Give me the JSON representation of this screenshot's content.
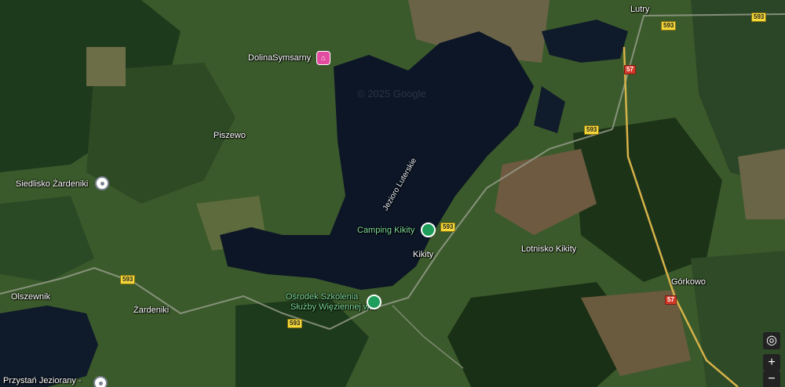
{
  "places": {
    "lutry": "Lutry",
    "dolina": "DolinaSymsarny",
    "piszewo": "Piszewo",
    "siedlisko": "Siedlisko Żardeniki",
    "camping": "Camping Kikity",
    "kikity": "Kikity",
    "lotnisko": "Lotnisko Kikity",
    "gorkowo": "Górkowo",
    "olszewnik": "Olszewnik",
    "zardeniki": "Żardeniki",
    "osrodek_line1": "Ośrodek Szkolenia",
    "osrodek_line2": "Służby Więziennej w...",
    "przystan": "Przystań Jeziorany -",
    "lake": "Jezioro Luterskie"
  },
  "roads": {
    "r593": "593",
    "r57": "57"
  },
  "watermark": "© 2025 Google",
  "controls": {
    "locate": "◎",
    "zoom_in": "+",
    "zoom_out": "−"
  },
  "colors": {
    "lake": "#0d1626",
    "farmland": "#3a5a2a",
    "forest": "#1c3318"
  }
}
